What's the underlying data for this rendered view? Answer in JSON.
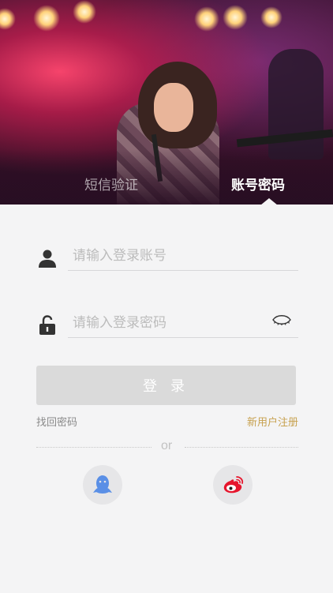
{
  "tabs": {
    "sms_label": "短信验证",
    "account_label": "账号密码"
  },
  "form": {
    "account_placeholder": "请输入登录账号",
    "password_placeholder": "请输入登录密码",
    "login_label": "登 录"
  },
  "links": {
    "forgot": "找回密码",
    "register": "新用户注册"
  },
  "divider": {
    "text": "or"
  },
  "social": [
    "qq-icon",
    "weibo-icon"
  ],
  "colors": {
    "background": "#f4f4f5",
    "login_button": "#dadada",
    "register_link": "#c7a14f",
    "qq": "#5a8fe6",
    "weibo": "#e6162d"
  }
}
